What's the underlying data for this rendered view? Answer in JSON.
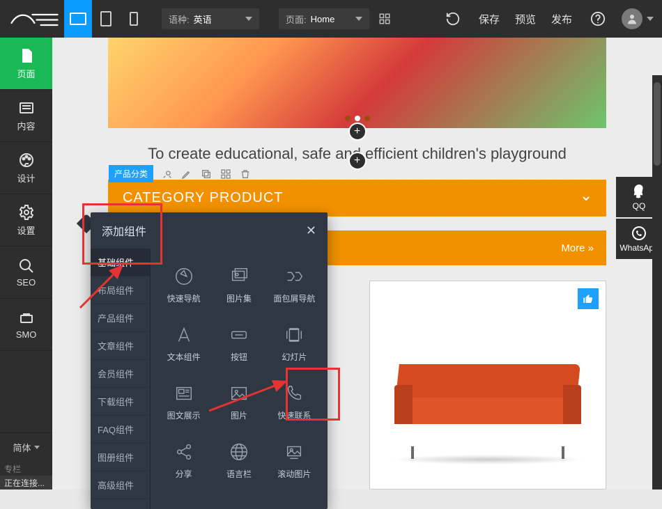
{
  "topbar": {
    "language_label": "语种:",
    "language_value": "英语",
    "page_label": "页面:",
    "page_value": "Home",
    "actions": {
      "save": "保存",
      "preview": "预览",
      "publish": "发布"
    }
  },
  "leftrail": {
    "items": [
      {
        "key": "page",
        "label": "页面"
      },
      {
        "key": "content",
        "label": "内容"
      },
      {
        "key": "design",
        "label": "设计"
      },
      {
        "key": "settings",
        "label": "设置"
      },
      {
        "key": "seo",
        "label": "SEO"
      },
      {
        "key": "smo",
        "label": "SMO"
      }
    ],
    "lang_switch": "简体",
    "cut_item": "专栏"
  },
  "statusbar": {
    "text": "正在连接..."
  },
  "stage": {
    "tagline": "To create educational, safe and efficient children's playground",
    "category": {
      "tag": "产品分类",
      "title": "CATEGORY PRODUCT"
    },
    "more": "More »"
  },
  "float_contacts": [
    {
      "key": "qq",
      "label": "QQ"
    },
    {
      "key": "whatsapp",
      "label": "WhatsApp"
    }
  ],
  "popover": {
    "title": "添加组件",
    "side": [
      "基础组件",
      "布局组件",
      "产品组件",
      "文章组件",
      "会员组件",
      "下载组件",
      "FAQ组件",
      "图册组件",
      "高级组件"
    ],
    "grid": [
      "快速导航",
      "图片集",
      "面包屑导航",
      "文本组件",
      "按钮",
      "幻灯片",
      "图文展示",
      "图片",
      "快速联系",
      "分享",
      "语言栏",
      "滚动图片"
    ]
  }
}
